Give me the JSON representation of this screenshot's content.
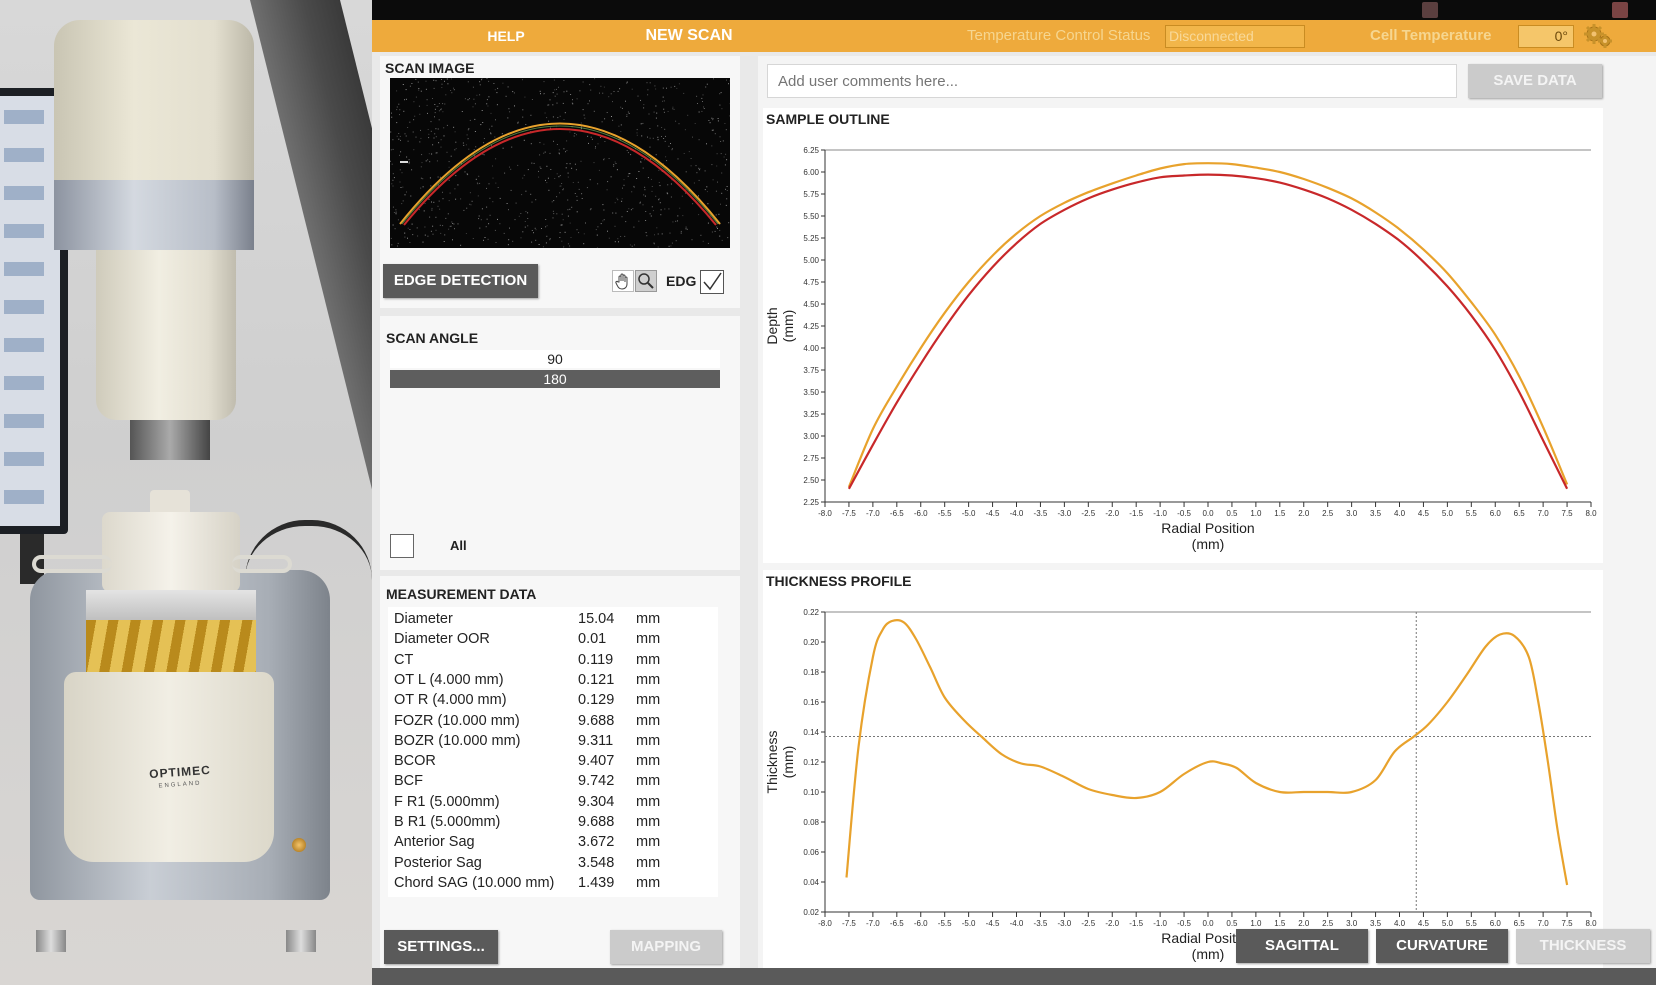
{
  "photo": {
    "brand": "OPTIMEC",
    "brand_sub": "ENGLAND"
  },
  "topbar": {
    "help_label": "HELP",
    "new_scan_label": "NEW SCAN",
    "temp_status_label": "Temperature Control Status",
    "temp_status_value": "Disconnected",
    "cell_temp_label": "Cell Temperature",
    "cell_temp_value": "0°"
  },
  "scan_image": {
    "title": "SCAN IMAGE",
    "edge_detection_label": "EDGE DETECTION",
    "edg_label": "EDG",
    "edg_checked": true
  },
  "scan_angle": {
    "title": "SCAN ANGLE",
    "options": [
      "90",
      "180"
    ],
    "selected": "180",
    "all_label": "All"
  },
  "measurement": {
    "title": "MEASUREMENT DATA",
    "rows": [
      {
        "label": "Diameter",
        "value": "15.04",
        "unit": "mm"
      },
      {
        "label": "Diameter OOR",
        "value": "0.01",
        "unit": "mm"
      },
      {
        "label": "CT",
        "value": "0.119",
        "unit": "mm"
      },
      {
        "label": "OT L (4.000 mm)",
        "value": "0.121",
        "unit": "mm"
      },
      {
        "label": "OT R (4.000 mm)",
        "value": "0.129",
        "unit": "mm"
      },
      {
        "label": "FOZR (10.000 mm)",
        "value": "9.688",
        "unit": "mm"
      },
      {
        "label": "BOZR (10.000 mm)",
        "value": "9.311",
        "unit": "mm"
      },
      {
        "label": "BCOR",
        "value": "9.407",
        "unit": "mm"
      },
      {
        "label": "BCF",
        "value": "9.742",
        "unit": "mm"
      },
      {
        "label": "F R1 (5.000mm)",
        "value": "9.304",
        "unit": "mm"
      },
      {
        "label": "B R1 (5.000mm)",
        "value": "9.688",
        "unit": "mm"
      },
      {
        "label": "Anterior Sag",
        "value": "3.672",
        "unit": "mm"
      },
      {
        "label": "Posterior Sag",
        "value": "3.548",
        "unit": "mm"
      },
      {
        "label": "Chord SAG (10.000 mm)",
        "value": "1.439",
        "unit": "mm"
      }
    ],
    "settings_label": "SETTINGS...",
    "mapping_label": "MAPPING"
  },
  "comments": {
    "placeholder": "Add user comments here...",
    "save_label": "SAVE DATA"
  },
  "bottom_buttons": {
    "sagittal": "SAGITTAL",
    "curvature": "CURVATURE",
    "thickness": "THICKNESS"
  },
  "colors": {
    "accent": "#eeaa3c",
    "anterior": "#e8a22c",
    "posterior": "#c8282a",
    "thickness": "#e8a22c",
    "button": "#5a5a5a"
  },
  "chart_data": [
    {
      "id": "sample-outline",
      "type": "line",
      "title": "SAMPLE OUTLINE",
      "xlabel": "Radial Position\n(mm)",
      "ylabel": "Depth\n(mm)",
      "xlim": [
        -8,
        8
      ],
      "ylim": [
        2.25,
        6.25
      ],
      "xticks": [
        -8,
        -7.5,
        -7,
        -6.5,
        -6,
        -5.5,
        -5,
        -4.5,
        -4,
        -3.5,
        -3,
        -2.5,
        -2,
        -1.5,
        -1,
        -0.5,
        0,
        0.5,
        1,
        1.5,
        2,
        2.5,
        3,
        3.5,
        4,
        4.5,
        5,
        5.5,
        6,
        6.5,
        7,
        7.5,
        8
      ],
      "xtick_labels": [
        "-8.0",
        "-7.5",
        "-7.0",
        "-6.5",
        "-6.0",
        "-5.5",
        "-5.0",
        "-4.5",
        "-4.0",
        "-3.5",
        "-3.0",
        "-2.5",
        "-2.0",
        "-1.5",
        "-1.0",
        "-0.5",
        "0.0",
        "0.5",
        "1.0",
        "1.5",
        "2.0",
        "2.5",
        "3.0",
        "3.5",
        "4.0",
        "4.5",
        "5.0",
        "5.5",
        "6.0",
        "6.5",
        "7.0",
        "7.5",
        "8.0"
      ],
      "yticks": [
        2.25,
        2.5,
        2.75,
        3.0,
        3.25,
        3.5,
        3.75,
        4.0,
        4.25,
        4.5,
        4.75,
        5.0,
        5.25,
        5.5,
        5.75,
        6.0,
        6.25
      ],
      "ytick_labels": [
        "2.25",
        "2.50",
        "2.75",
        "3.00",
        "3.25",
        "3.50",
        "3.75",
        "4.00",
        "4.25",
        "4.50",
        "4.75",
        "5.00",
        "5.25",
        "5.50",
        "5.75",
        "6.00",
        "6.25"
      ],
      "series": [
        {
          "id": "anterior",
          "x": [
            -7.5,
            -7,
            -6.5,
            -6,
            -5.5,
            -5,
            -4.5,
            -4,
            -3.5,
            -3,
            -2.5,
            -2,
            -1.5,
            -1,
            -0.5,
            0,
            0.5,
            1,
            1.5,
            2,
            2.5,
            3,
            3.5,
            4,
            4.5,
            5,
            5.5,
            6,
            6.5,
            7,
            7.5
          ],
          "y": [
            2.42,
            3.08,
            3.56,
            4.0,
            4.4,
            4.75,
            5.05,
            5.3,
            5.5,
            5.65,
            5.77,
            5.87,
            5.96,
            6.04,
            6.09,
            6.1,
            6.09,
            6.05,
            6.0,
            5.92,
            5.82,
            5.7,
            5.54,
            5.35,
            5.12,
            4.85,
            4.52,
            4.15,
            3.68,
            3.1,
            2.45
          ]
        },
        {
          "id": "posterior",
          "x": [
            -7.5,
            -7,
            -6.5,
            -6,
            -5.5,
            -5,
            -4.5,
            -4,
            -3.5,
            -3,
            -2.5,
            -2,
            -1.5,
            -1,
            -0.5,
            0,
            0.5,
            1,
            1.5,
            2,
            2.5,
            3,
            3.5,
            4,
            4.5,
            5,
            5.5,
            6,
            6.5,
            7,
            7.5
          ],
          "y": [
            2.4,
            2.9,
            3.38,
            3.82,
            4.23,
            4.6,
            4.92,
            5.19,
            5.41,
            5.57,
            5.7,
            5.8,
            5.88,
            5.94,
            5.96,
            5.97,
            5.96,
            5.93,
            5.88,
            5.8,
            5.7,
            5.57,
            5.41,
            5.22,
            4.98,
            4.7,
            4.37,
            3.98,
            3.5,
            2.95,
            2.4
          ]
        }
      ]
    },
    {
      "id": "thickness-profile",
      "type": "line",
      "title": "THICKNESS PROFILE",
      "xlabel": "Radial Position\n(mm)",
      "ylabel": "Thickness\n(mm)",
      "xlim": [
        -8,
        8
      ],
      "ylim": [
        0.02,
        0.22
      ],
      "xticks": [
        -8,
        -7.5,
        -7,
        -6.5,
        -6,
        -5.5,
        -5,
        -4.5,
        -4,
        -3.5,
        -3,
        -2.5,
        -2,
        -1.5,
        -1,
        -0.5,
        0,
        0.5,
        1,
        1.5,
        2,
        2.5,
        3,
        3.5,
        4,
        4.5,
        5,
        5.5,
        6,
        6.5,
        7,
        7.5,
        8
      ],
      "xtick_labels": [
        "-8.0",
        "-7.5",
        "-7.0",
        "-6.5",
        "-6.0",
        "-5.5",
        "-5.0",
        "-4.5",
        "-4.0",
        "-3.5",
        "-3.0",
        "-2.5",
        "-2.0",
        "-1.5",
        "-1.0",
        "-0.5",
        "0.0",
        "0.5",
        "1.0",
        "1.5",
        "2.0",
        "2.5",
        "3.0",
        "3.5",
        "4.0",
        "4.5",
        "5.0",
        "5.5",
        "6.0",
        "6.5",
        "7.0",
        "7.5",
        "8.0"
      ],
      "yticks": [
        0.02,
        0.04,
        0.06,
        0.08,
        0.1,
        0.12,
        0.14,
        0.16,
        0.18,
        0.2,
        0.22
      ],
      "ytick_labels": [
        "0.02",
        "0.04",
        "0.06",
        "0.08",
        "0.10",
        "0.12",
        "0.14",
        "0.16",
        "0.18",
        "0.20",
        "0.22"
      ],
      "cursor": {
        "x": 4.35,
        "y": 0.137
      },
      "series": [
        {
          "id": "thickness",
          "x": [
            -7.55,
            -7.3,
            -7.0,
            -6.8,
            -6.6,
            -6.35,
            -6.1,
            -5.8,
            -5.5,
            -5.1,
            -4.7,
            -4.3,
            -3.9,
            -3.5,
            -3.0,
            -2.5,
            -2.0,
            -1.5,
            -1.0,
            -0.5,
            0.0,
            0.3,
            0.6,
            1.0,
            1.5,
            2.0,
            2.5,
            3.0,
            3.5,
            3.9,
            4.3,
            4.6,
            5.0,
            5.4,
            5.8,
            6.1,
            6.4,
            6.7,
            6.9,
            7.1,
            7.3,
            7.5
          ],
          "y": [
            0.043,
            0.13,
            0.19,
            0.208,
            0.214,
            0.213,
            0.202,
            0.183,
            0.163,
            0.148,
            0.136,
            0.125,
            0.119,
            0.117,
            0.11,
            0.102,
            0.098,
            0.096,
            0.1,
            0.112,
            0.12,
            0.119,
            0.116,
            0.106,
            0.1,
            0.1,
            0.1,
            0.1,
            0.108,
            0.127,
            0.137,
            0.145,
            0.16,
            0.178,
            0.197,
            0.205,
            0.204,
            0.19,
            0.16,
            0.12,
            0.075,
            0.038
          ]
        }
      ]
    }
  ]
}
